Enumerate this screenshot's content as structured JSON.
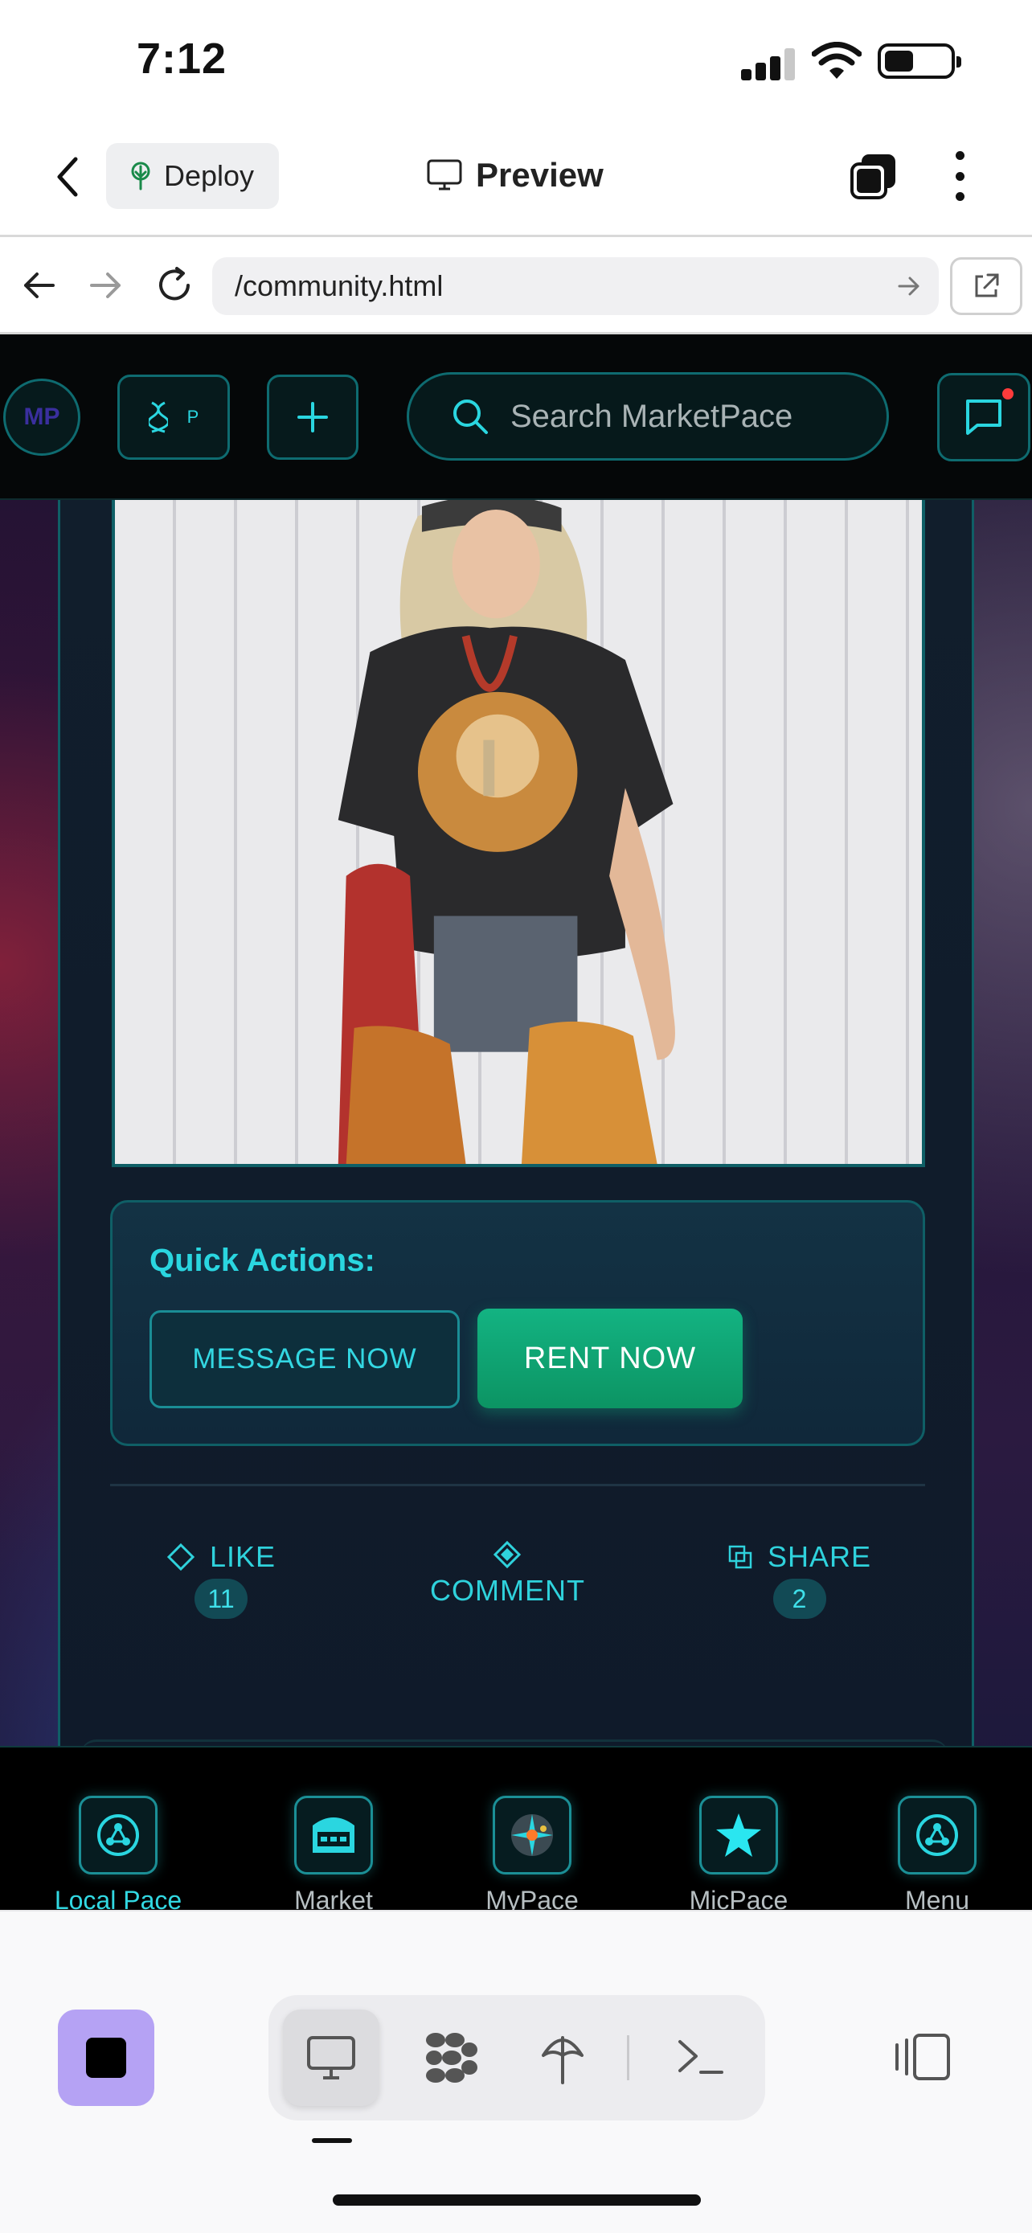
{
  "status_bar": {
    "time": "7:12",
    "battery_level": 0.45
  },
  "app_bar": {
    "deploy_label": "Deploy",
    "preview_label": "Preview"
  },
  "browser": {
    "url": "/community.html"
  },
  "site_header": {
    "logo_text": "MP",
    "dna_badge_text": "P",
    "search_placeholder": "Search MarketPace",
    "has_notification": true
  },
  "quick_actions": {
    "title": "Quick Actions:",
    "message_label": "MESSAGE NOW",
    "rent_label": "RENT NOW"
  },
  "post_actions": {
    "like_label": "LIKE",
    "like_count": "11",
    "comment_label": "COMMENT",
    "share_label": "SHARE",
    "share_count": "2"
  },
  "bottom_nav": {
    "items": [
      {
        "label": "Local Pace",
        "icon": "local-pace-icon",
        "active": true
      },
      {
        "label": "Market",
        "icon": "market-icon",
        "active": false
      },
      {
        "label": "MyPace",
        "icon": "mypace-icon",
        "active": false
      },
      {
        "label": "MicPace",
        "icon": "star-icon",
        "active": false
      },
      {
        "label": "Menu",
        "icon": "menu-icon",
        "active": false
      }
    ]
  },
  "colors": {
    "accent_cyan": "#2ad6e0",
    "rent_green": "#13b382",
    "stop_purple": "#b5a2f4"
  }
}
